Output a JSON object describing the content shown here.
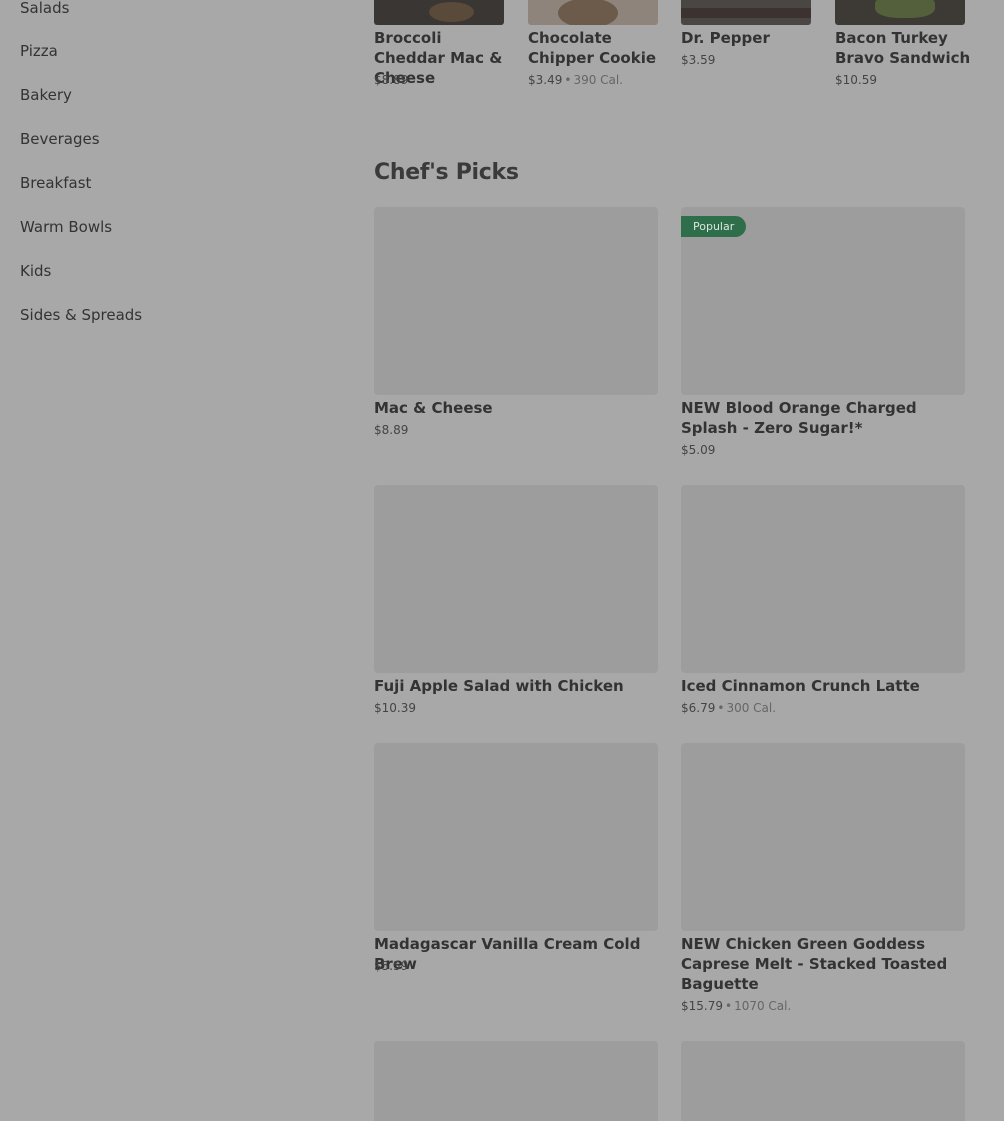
{
  "sidebar": {
    "items": [
      {
        "label": "Salads"
      },
      {
        "label": "Pizza"
      },
      {
        "label": "Bakery"
      },
      {
        "label": "Beverages"
      },
      {
        "label": "Breakfast"
      },
      {
        "label": "Warm Bowls"
      },
      {
        "label": "Kids"
      },
      {
        "label": "Sides & Spreads"
      }
    ]
  },
  "top_items": [
    {
      "name": "Broccoli Cheddar Mac & Cheese",
      "price": "$8.89",
      "cal": ""
    },
    {
      "name": "Chocolate Chipper Cookie",
      "price": "$3.49",
      "cal": "390 Cal."
    },
    {
      "name": "Dr. Pepper",
      "price": "$3.59",
      "cal": ""
    },
    {
      "name": "Bacon Turkey Bravo Sandwich",
      "price": "$10.59",
      "cal": ""
    }
  ],
  "section": {
    "title": "Chef's Picks"
  },
  "picks": [
    {
      "name": "Mac & Cheese",
      "price": "$8.89",
      "cal": "",
      "badge": ""
    },
    {
      "name": "NEW Blood Orange Charged Splash - Zero Sugar!*",
      "price": "$5.09",
      "cal": "",
      "badge": "Popular"
    },
    {
      "name": "Fuji Apple Salad with Chicken",
      "price": "$10.39",
      "cal": "",
      "badge": ""
    },
    {
      "name": "Iced Cinnamon Crunch Latte",
      "price": "$6.79",
      "cal": "300 Cal.",
      "badge": ""
    },
    {
      "name": "Madagascar Vanilla Cream Cold Brew",
      "price": "$5.59",
      "cal": "",
      "badge": ""
    },
    {
      "name": "NEW Chicken Green Goddess Caprese Melt - Stacked Toasted Baguette",
      "price": "$15.79",
      "cal": "1070 Cal.",
      "badge": ""
    }
  ],
  "dot": "•"
}
